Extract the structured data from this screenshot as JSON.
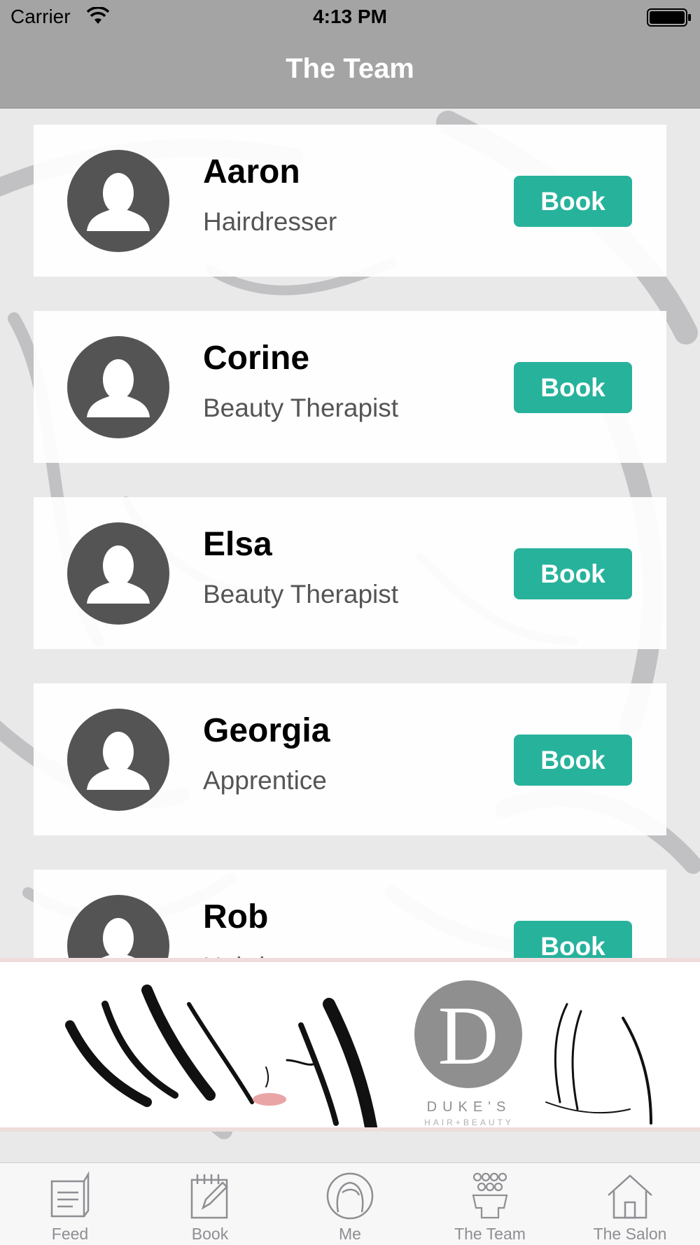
{
  "status_bar": {
    "carrier": "Carrier",
    "time": "4:13 PM"
  },
  "nav": {
    "title": "The Team"
  },
  "team": [
    {
      "name": "Aaron",
      "role": "Hairdresser",
      "button": "Book"
    },
    {
      "name": "Corine",
      "role": "Beauty Therapist",
      "button": "Book"
    },
    {
      "name": "Elsa",
      "role": "Beauty Therapist",
      "button": "Book"
    },
    {
      "name": "Georgia",
      "role": "Apprentice",
      "button": "Book"
    },
    {
      "name": "Rob",
      "role": "Hairdresser",
      "button": "Book"
    }
  ],
  "banner": {
    "logo_letter": "D",
    "logo_name": "DUKE'S",
    "logo_tagline": "HAIR+BEAUTY"
  },
  "tabs": [
    {
      "label": "Feed",
      "icon": "feed-icon"
    },
    {
      "label": "Book",
      "icon": "book-icon"
    },
    {
      "label": "Me",
      "icon": "me-icon"
    },
    {
      "label": "The Team",
      "icon": "team-icon"
    },
    {
      "label": "The Salon",
      "icon": "salon-icon"
    }
  ],
  "colors": {
    "accent": "#27b29c",
    "nav_background": "#a4a4a4",
    "avatar": "#545454",
    "tab_inactive": "#8e8e93"
  }
}
